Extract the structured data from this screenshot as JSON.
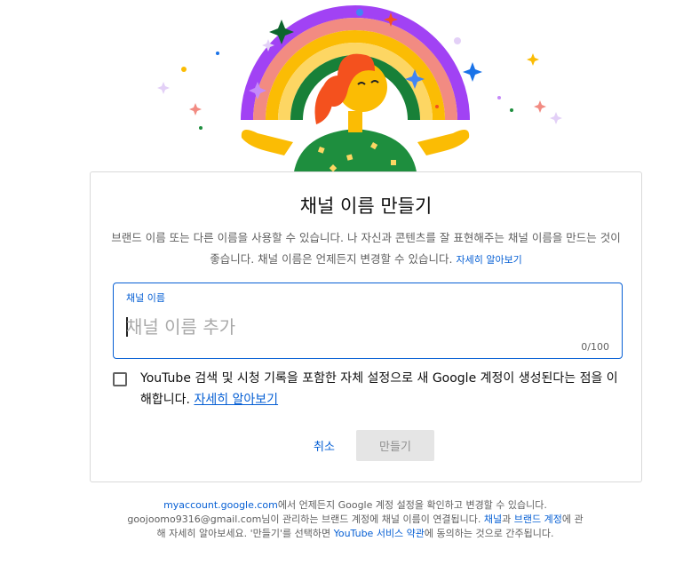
{
  "dialog": {
    "title": "채널 이름 만들기",
    "description": "브랜드 이름 또는 다른 이름을 사용할 수 있습니다. 나 자신과 콘텐츠를 잘 표현해주는 채널 이름을 만드는 것이 좋습니다. 채널 이름은 언제든지 변경할 수 있습니다.",
    "learn_more": "자세히 알아보기",
    "field": {
      "label": "채널 이름",
      "placeholder": "채널 이름 추가",
      "value": "",
      "counter": "0/100"
    },
    "consent": {
      "checked": false,
      "text": "YouTube 검색 및 시청 기록을 포함한 자체 설정으로 새 Google 계정이 생성된다는 점을 이해합니다.",
      "link": "자세히 알아보기"
    },
    "buttons": {
      "cancel": "취소",
      "create": "만들기"
    }
  },
  "footer": {
    "account_link": "myaccount.google.com",
    "line1_rest": "에서 언제든지 Google 계정 설정을 확인하고 변경할 수 있습니다.",
    "email": "goojoomo9316@gmail.com",
    "line2_mid": "님이 관리하는 브랜드 계정에 채널 이름이 연결됩니다. ",
    "channel_link": "채널",
    "and": "과 ",
    "brand_link": "브랜드 계정",
    "line2_end": "에 관해 자세히 알아보세요. '만들기'를 선택하면 ",
    "terms_link": "YouTube 서비스 약관",
    "line3_end": "에 동의하는 것으로 간주됩니다."
  },
  "colors": {
    "accent": "#065fd4",
    "rainbow": [
      "#a142f4",
      "#f28b82",
      "#fbbc04",
      "#fdd663",
      "#188038",
      "#fff"
    ]
  }
}
